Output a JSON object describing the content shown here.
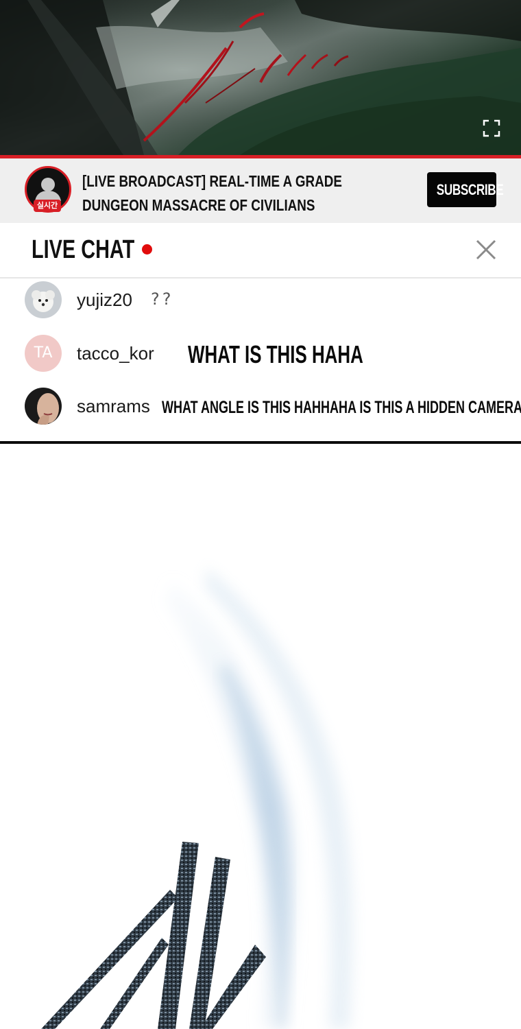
{
  "stream": {
    "title_line1": "[Live Broadcast] Real-Time A Grade",
    "title_line2": "Dungeon Massacre of Civilians",
    "live_badge": "실시간",
    "subscribe_label": "SUBSCRIBE"
  },
  "chat": {
    "title": "LIVE CHAT",
    "messages": [
      {
        "username": "yujiz20",
        "text": "??"
      },
      {
        "username": "tacco_kor",
        "initials": "TA",
        "text": "WHAT IS THIS HAHA"
      },
      {
        "username": "samrams",
        "text": "WHAT ANGLE IS THIS HAHHAHA IS THIS A HIDDEN CAMERA?"
      }
    ]
  },
  "colors": {
    "accent_red": "#d81f26",
    "live_dot": "#e10c0c",
    "subscribe_bg": "#050505",
    "channel_bar_bg": "#efefef"
  },
  "icons": {
    "fullscreen": "fullscreen-icon",
    "close": "close-icon",
    "live": "live-dot-icon",
    "channel_avatar": "user-avatar-icon"
  }
}
